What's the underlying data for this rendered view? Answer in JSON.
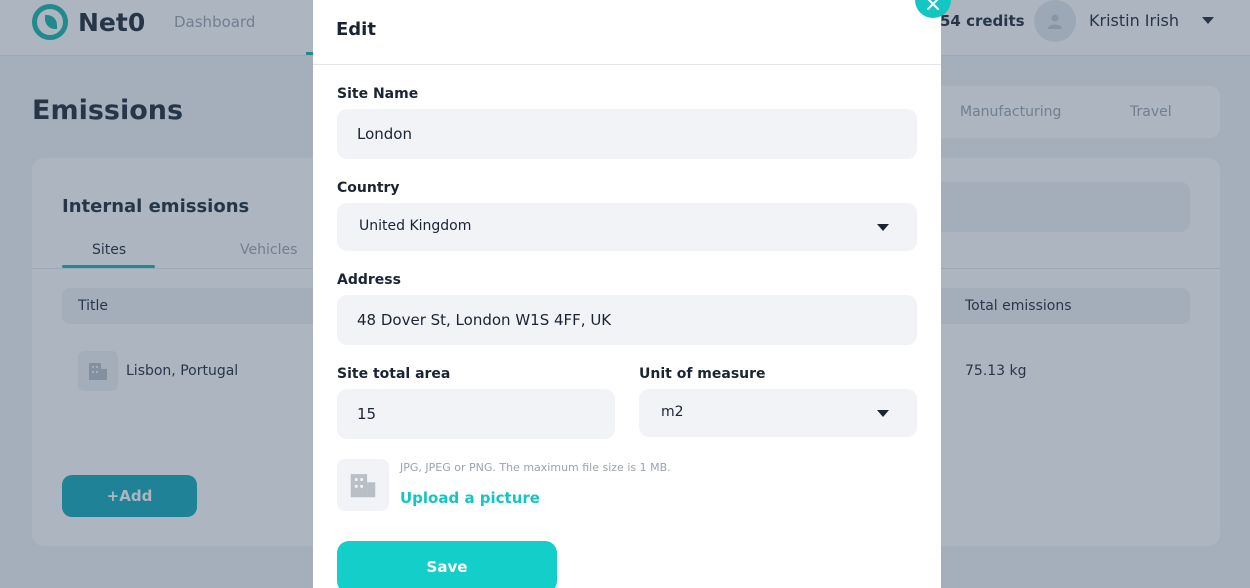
{
  "app": {
    "logo_text": "Net0",
    "nav": {
      "dashboard": "Dashboard"
    },
    "credits": "54 credits",
    "user_name": "Kristin Irish"
  },
  "page": {
    "title": "Emissions",
    "category_tabs": [
      "Manufacturing",
      "Travel"
    ],
    "card_title": "Internal emissions",
    "sub_tabs": [
      "Sites",
      "Vehicles"
    ],
    "table": {
      "headers": [
        "Title",
        "Total emissions"
      ],
      "rows": [
        {
          "title": "Lisbon, Portugal",
          "total": "75.13 kg"
        }
      ]
    },
    "add_label": "+Add"
  },
  "modal": {
    "title": "Edit",
    "site_name_label": "Site Name",
    "site_name_value": "London",
    "country_label": "Country",
    "country_value": "United Kingdom",
    "address_label": "Address",
    "address_value": "48 Dover St, London W1S 4FF, UK",
    "area_label": "Site total area",
    "area_value": "15",
    "unit_label": "Unit of measure",
    "unit_value": "m2",
    "upload_hint": "JPG, JPEG or PNG. The maximum file size is 1 MB.",
    "upload_label": "Upload a picture",
    "save_label": "Save"
  },
  "colors": {
    "accent": "#14c6c1",
    "overlay": "#3a4e68"
  }
}
